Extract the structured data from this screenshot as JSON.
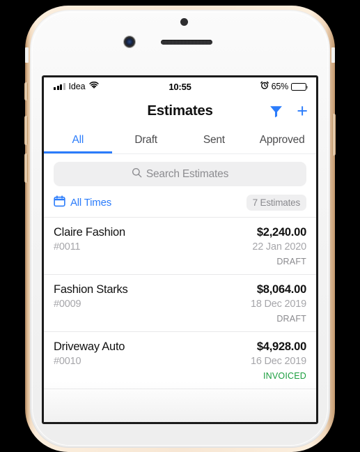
{
  "device": {
    "frame_color": "#f7e6d3",
    "band_accent": "#d9b48c",
    "screen_bg": "#ffffff"
  },
  "status_bar": {
    "carrier": "Idea",
    "signal_icon": "signal-bars-icon",
    "wifi_icon": "wifi-icon",
    "time": "10:55",
    "alarm_icon": "alarm-clock-icon",
    "battery_percent": "65%",
    "battery_level": 65,
    "battery_icon": "battery-icon"
  },
  "nav_bar": {
    "title": "Estimates",
    "filter_icon": "filter-funnel-icon",
    "add_icon": "plus-icon",
    "accent": "#2b7cfb"
  },
  "tabs": {
    "items": [
      {
        "label": "All",
        "active": true
      },
      {
        "label": "Draft",
        "active": false
      },
      {
        "label": "Sent",
        "active": false
      },
      {
        "label": "Approved",
        "active": false
      }
    ],
    "active_index": 0,
    "active_color": "#2b7cfb",
    "inactive_color": "#4c4c4e"
  },
  "search": {
    "placeholder": "Search Estimates",
    "icon": "search-icon",
    "value": ""
  },
  "filter_row": {
    "calendar_icon": "calendar-icon",
    "range_label": "All Times",
    "count_label": "7 Estimates"
  },
  "list": {
    "rows": [
      {
        "name": "Claire Fashion",
        "number": "#0011",
        "amount": "$2,240.00",
        "date": "22 Jan 2020",
        "status": "DRAFT",
        "status_kind": "draft"
      },
      {
        "name": "Fashion Starks",
        "number": "#0009",
        "amount": "$8,064.00",
        "date": "18 Dec 2019",
        "status": "DRAFT",
        "status_kind": "draft"
      },
      {
        "name": "Driveway Auto",
        "number": "#0010",
        "amount": "$4,928.00",
        "date": "16 Dec 2019",
        "status": "INVOICED",
        "status_kind": "invoiced"
      }
    ],
    "status_colors": {
      "draft": "#8a8a8e",
      "invoiced": "#1a9e3e"
    }
  }
}
